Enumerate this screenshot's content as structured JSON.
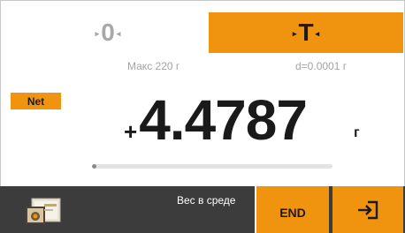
{
  "keys": {
    "zero": {
      "symbol": "0",
      "arrow_left": "▸",
      "arrow_right": "◂"
    },
    "tare": {
      "symbol": "T",
      "arrow_left": "▸",
      "arrow_right": "◂"
    }
  },
  "info": {
    "max": "Макс 220 г",
    "division": "d=0.0001 г"
  },
  "net_label": "Net",
  "weight": {
    "sign": "+",
    "value": "4.4787",
    "unit": "г"
  },
  "capacity_bar": {
    "fraction": 0.02
  },
  "bottom": {
    "mode_label": "Вес в среде",
    "end_label": "END",
    "exit_icon": "exit-icon",
    "app_icon": "application-icon"
  },
  "colors": {
    "accent": "#f0940f",
    "bottom_bar": "#3c3c3c",
    "muted_text": "#a3a3a3"
  }
}
